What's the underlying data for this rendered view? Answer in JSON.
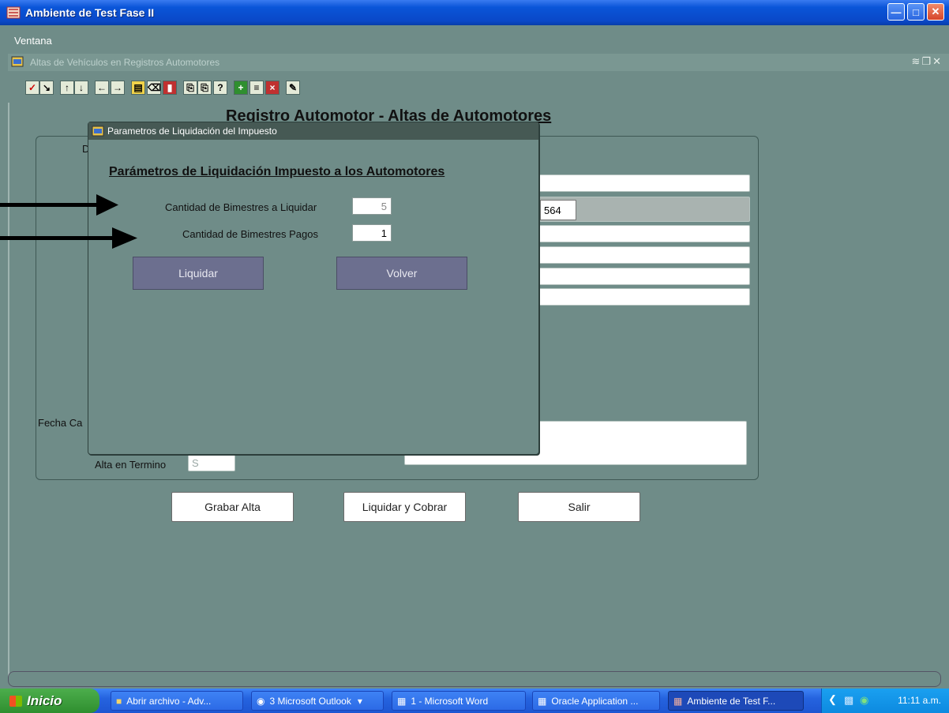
{
  "window": {
    "title": "Ambiente de Test Fase II"
  },
  "menu": {
    "ventana": "Ventana"
  },
  "inner_window": {
    "title": "Altas de Vehículos en Registros Automotores"
  },
  "form": {
    "heading": "Registro Automotor - Altas de Automotores",
    "fragment_d": "D",
    "fecha_label_fragment": "Fecha Ca",
    "field_value_564": "564",
    "alta_en_termino_label": "Alta en Termino",
    "alta_en_termino_value": "S",
    "buttons": {
      "grabar": "Grabar Alta",
      "liquidar_cobrar": "Liquidar y Cobrar",
      "salir": "Salir"
    }
  },
  "dialog": {
    "title": "Parametros de Liquidación del Impuesto",
    "heading": "Parámetros de Liquidación Impuesto a los Automotores",
    "bimestres_liquidar_label": "Cantidad de Bimestres a Liquidar",
    "bimestres_liquidar_value": "5",
    "bimestres_pagos_label": "Cantidad de Bimestres Pagos",
    "bimestres_pagos_value": "1",
    "liquidar_button": "Liquidar",
    "volver_button": "Volver"
  },
  "taskbar": {
    "start": "Inicio",
    "items": [
      "Abrir archivo - Adv...",
      "3 Microsoft Outlook",
      "1 - Microsoft Word",
      "Oracle Application ...",
      "Ambiente de Test F..."
    ],
    "clock": "11:11 a.m."
  },
  "colors": {
    "background": "#6f8c88",
    "dialog_button": "#6c6f8f",
    "title_bar": "#0a55d8"
  }
}
